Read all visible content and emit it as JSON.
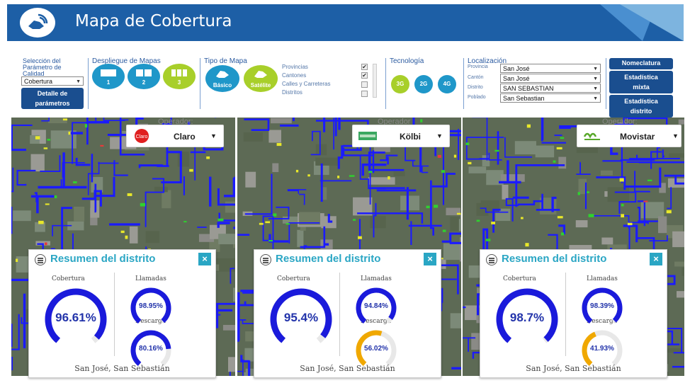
{
  "header": {
    "title": "Mapa de Cobertura"
  },
  "controls": {
    "quality": {
      "title_l1": "Selección del",
      "title_l2": "Parámetro de",
      "title_l3": "Calidad",
      "selected": "Cobertura",
      "details_l1": "Detalle de",
      "details_l2": "parámetros"
    },
    "display": {
      "title": "Despliegue de Mapas",
      "options": [
        "1",
        "2",
        "3"
      ]
    },
    "map_type": {
      "title": "Tipo de Mapa",
      "basic": "Básico",
      "satellite": "Satélite",
      "layers": [
        "Provincias",
        "Cantones",
        "Calles y Carreteras",
        "Distritos"
      ],
      "checked": [
        true,
        true,
        false,
        false
      ]
    },
    "technology": {
      "title": "Tecnología",
      "options": [
        "3G",
        "2G",
        "4G"
      ]
    },
    "location": {
      "title": "Localización",
      "fields": [
        {
          "label": "Provincia",
          "value": "San José"
        },
        {
          "label": "Cantón",
          "value": "San José"
        },
        {
          "label": "Distrito",
          "value": "SAN SEBASTIAN"
        },
        {
          "label": "Poblado",
          "value": "San Sebastian"
        }
      ]
    },
    "buttons": {
      "nomenclature": "Nomeclatura",
      "mixed_l1": "Estadística",
      "mixed_l2": "mixta",
      "district_l1": "Estadística",
      "district_l2": "distrito"
    }
  },
  "panels": [
    {
      "operator_label": "Operador:",
      "operator": "Claro",
      "summary_title": "Resumen del distrito",
      "coverage_label": "Cobertura",
      "coverage": "96.61%",
      "coverage_value": 96.61,
      "calls_label": "Llamadas",
      "calls": "98.95%",
      "calls_value": 98.95,
      "download_label": "Descarga",
      "download": "80.16%",
      "download_value": 80.16,
      "download_color": "#1a1adb",
      "footer": "San José, San Sebastián"
    },
    {
      "operator_label": "Operador",
      "operator": "Kölbi",
      "summary_title": "Resumen del distrito",
      "coverage_label": "Cobertura",
      "coverage": "95.4%",
      "coverage_value": 95.4,
      "calls_label": "Llamadas",
      "calls": "94.84%",
      "calls_value": 94.84,
      "download_label": "Descarga",
      "download": "56.02%",
      "download_value": 56.02,
      "download_color": "#f0a800",
      "footer": "San José, San Sebastián"
    },
    {
      "operator_label": "Operador:",
      "operator": "Movistar",
      "summary_title": "Resumen del distrito",
      "coverage_label": "Cobertura",
      "coverage": "98.7%",
      "coverage_value": 98.7,
      "calls_label": "Llamadas",
      "calls": "98.39%",
      "calls_value": 98.39,
      "download_label": "Descarga",
      "download": "41.93%",
      "download_value": 41.93,
      "download_color": "#f0a800",
      "footer": "San José, San Sebastián"
    }
  ],
  "colors": {
    "header": "#1d5fa6",
    "gauge_blue": "#1a1adb",
    "gauge_orange": "#f0a800",
    "accent_teal": "#2aa6c4"
  }
}
